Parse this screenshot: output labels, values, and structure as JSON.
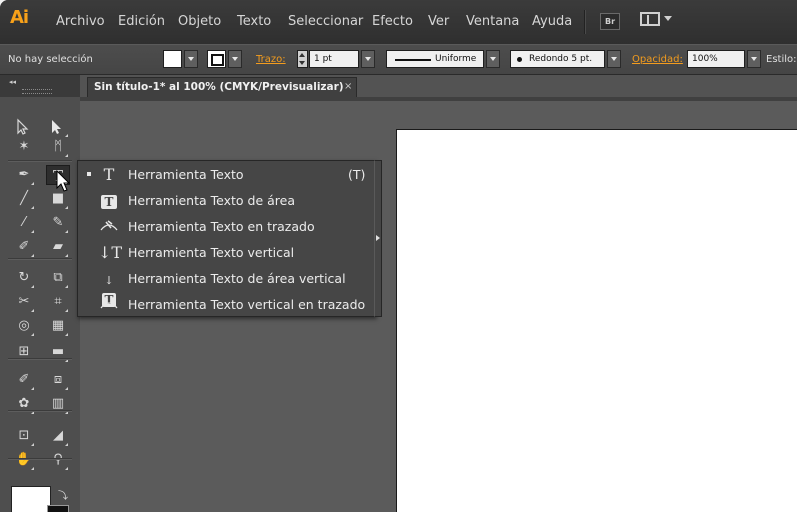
{
  "app": {
    "logo": "Ai"
  },
  "menubar": {
    "items": [
      "Archivo",
      "Edición",
      "Objeto",
      "Texto",
      "Seleccionar",
      "Efecto",
      "Ver",
      "Ventana",
      "Ayuda"
    ],
    "bridge_button": "Br",
    "workspace_icon": "workspace-layout-icon"
  },
  "controlbar": {
    "selection_status": "No hay selección",
    "stroke_label": "Trazo:",
    "stroke_weight": "1 pt",
    "stroke_profile": "Uniforme",
    "brush": "Redondo 5 pt.",
    "opacity_label": "Opacidad:",
    "opacity_value": "100%",
    "style_label": "Estilo:"
  },
  "document": {
    "tab_title": "Sin título-1* al 100% (CMYK/Previsualizar)",
    "tab_close": "×"
  },
  "toolbar": {
    "collapse": "◂◂",
    "tools": [
      "selection-tool",
      "direct-selection-tool",
      "magic-wand-tool",
      "lasso-tool",
      "pen-tool",
      "type-tool",
      "line-segment-tool",
      "rectangle-tool",
      "paintbrush-tool",
      "pencil-tool",
      "blob-brush-tool",
      "eraser-tool",
      "rotate-tool",
      "scale-tool",
      "width-tool",
      "free-transform-tool",
      "shape-builder-tool",
      "perspective-grid-tool",
      "mesh-tool",
      "gradient-tool",
      "eyedropper-tool",
      "blend-tool",
      "symbol-sprayer-tool",
      "column-graph-tool",
      "artboard-tool",
      "slice-tool",
      "hand-tool",
      "zoom-tool"
    ]
  },
  "flyout": {
    "items": [
      {
        "icon": "T",
        "label": "Herramienta Texto",
        "shortcut": "(T)",
        "selected": true
      },
      {
        "icon": "T",
        "label": "Herramienta Texto de área"
      },
      {
        "icon": "✓",
        "label": "Herramienta Texto en trazado"
      },
      {
        "icon": "↓T",
        "label": "Herramienta Texto vertical"
      },
      {
        "icon": "↓T",
        "label": "Herramienta Texto de área vertical"
      },
      {
        "icon": "✓",
        "label": "Herramienta Texto vertical en trazado"
      }
    ]
  },
  "colors": {
    "accent": "#f7a11a",
    "panel": "#535353",
    "menubar": "#323232"
  }
}
